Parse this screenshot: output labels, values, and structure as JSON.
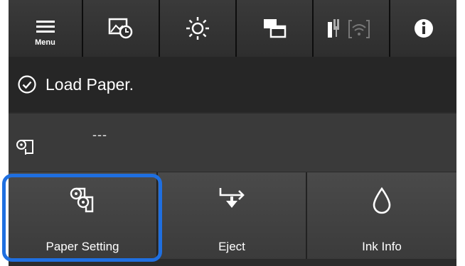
{
  "toolbar": {
    "menu_label": "Menu",
    "icons": [
      "menu-icon",
      "image-timer-icon",
      "brightness-icon",
      "windows-icon",
      "network-icon",
      "info-icon"
    ]
  },
  "status": {
    "message": "Load Paper.",
    "icon": "check-circle-icon"
  },
  "paper": {
    "value": "---",
    "icon": "paper-roll-icon"
  },
  "buttons": {
    "paper_setting": "Paper Setting",
    "eject": "Eject",
    "ink_info": "Ink Info"
  },
  "colors": {
    "highlight": "#1f6fe0",
    "panel": "#2b2b2b"
  }
}
